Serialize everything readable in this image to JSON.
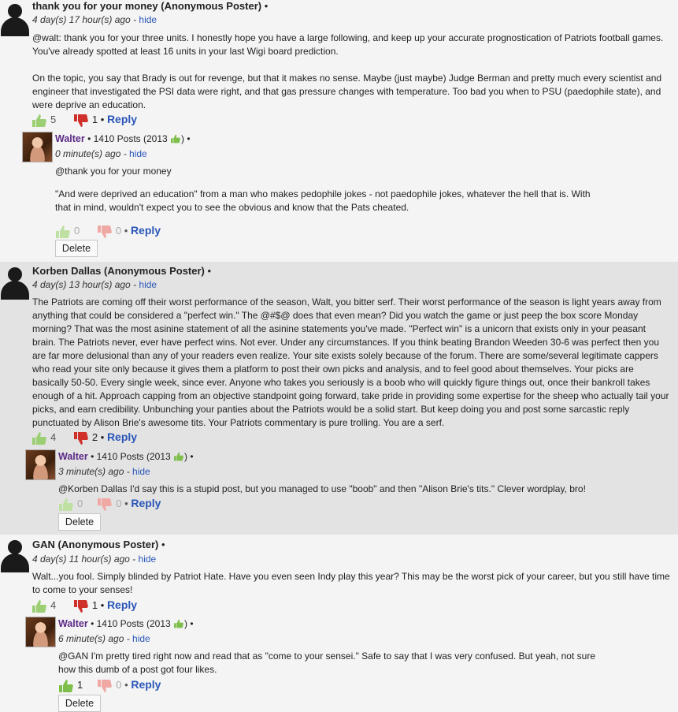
{
  "comments": [
    {
      "author": "thank you for your money (Anonymous Poster)",
      "time": "4 day(s) 17 hour(s) ago",
      "hide": "hide",
      "paragraphs": [
        "@walt: thank you for your three units. I honestly hope you have a large following, and keep up your accurate prognostication of Patriots football games. You've already spotted at least 16 units in your last Wigi board prediction.",
        "On the topic, you say that Brady is out for revenge, but that it makes no sense. Maybe (just maybe) Judge Berman and pretty much every scientist and engineer that investigated the PSI data were right, and that gas pressure changes with temperature. Too bad you when to PSU (paedophile state), and were deprive an education."
      ],
      "up": "5",
      "down": "1",
      "reply": "Reply",
      "reply_item": {
        "author": "Walter",
        "posts": "1410 Posts (2013",
        "time": "0 minute(s) ago",
        "hide": "hide",
        "paragraphs": [
          "@thank you for your money",
          "\"And were deprived an education\" from a man who makes pedophile jokes - not paedophile jokes, whatever the hell that is. With that in mind, wouldn't expect you to see the obvious and know that the Pats cheated."
        ],
        "up": "0",
        "down": "0",
        "reply": "Reply",
        "delete": "Delete"
      }
    },
    {
      "author": "Korben Dallas (Anonymous Poster)",
      "time": "4 day(s) 13 hour(s) ago",
      "hide": "hide",
      "paragraphs": [
        "The Patriots are coming off their worst performance of the season, Walt, you bitter serf. Their worst performance of the season is light years away from anything that could be considered a \"perfect win.\" The @#$@ does that even mean? Did you watch the game or just peep the box score Monday morning? That was the most asinine statement of all the asinine statements you've made. \"Perfect win\" is a unicorn that exists only in your peasant brain. The Patriots never, ever have perfect wins. Not ever. Under any circumstances. If you think beating Brandon Weeden 30-6 was perfect then you are far more delusional than any of your readers even realize. Your site exists solely because of the forum. There are some/several legitimate cappers who read your site only because it gives them a platform to post their own picks and analysis, and to feel good about themselves. Your picks are basically 50-50. Every single week, since ever. Anyone who takes you seriously is a boob who will quickly figure things out, once their bankroll takes enough of a hit. Approach capping from an objective standpoint going forward, take pride in providing some expertise for the sheep who actually tail your picks, and earn credibility. Unbunching your panties about the Patriots would be a solid start. But keep doing you and post some sarcastic reply punctuated by Alison Brie's awesome tits. Your Patriots commentary is pure trolling. You are a serf."
      ],
      "up": "4",
      "down": "2",
      "reply": "Reply",
      "reply_item": {
        "author": "Walter",
        "posts": "1410 Posts (2013",
        "time": "3 minute(s) ago",
        "hide": "hide",
        "paragraphs": [
          "@Korben Dallas I'd say this is a stupid post, but you managed to use \"boob\" and then \"Alison Brie's tits.\" Clever wordplay, bro!"
        ],
        "up": "0",
        "down": "0",
        "reply": "Reply",
        "delete": "Delete"
      }
    },
    {
      "author": "GAN (Anonymous Poster)",
      "time": "4 day(s) 11 hour(s) ago",
      "hide": "hide",
      "paragraphs": [
        "Walt...you fool.  Simply blinded by Patriot Hate.  Have you even seen Indy play this year?  This may be the worst pick of your career, but you still have time to come to your senses!"
      ],
      "up": "4",
      "down": "1",
      "reply": "Reply",
      "reply_item": {
        "author": "Walter",
        "posts": "1410 Posts (2013",
        "time": "6 minute(s) ago",
        "hide": "hide",
        "paragraphs": [
          "@GAN I'm pretty tired right now and read that as \"come to your sensei.\" Safe to say that I was very confused. But yeah, not sure how this dumb of a post got four likes."
        ],
        "up": "1",
        "down": "0",
        "reply": "Reply",
        "delete": "Delete"
      }
    }
  ],
  "icons": {
    "thumb_up": "thumbs-up-icon",
    "thumb_down": "thumbs-down-icon",
    "avatar": "anonymous-avatar-icon"
  },
  "colors": {
    "link": "#2a56b8",
    "username": "#5b2a86",
    "thumb_up": "#7dbf4a",
    "thumb_down": "#d0302a",
    "highlight_bg": "#e3e3e3"
  }
}
